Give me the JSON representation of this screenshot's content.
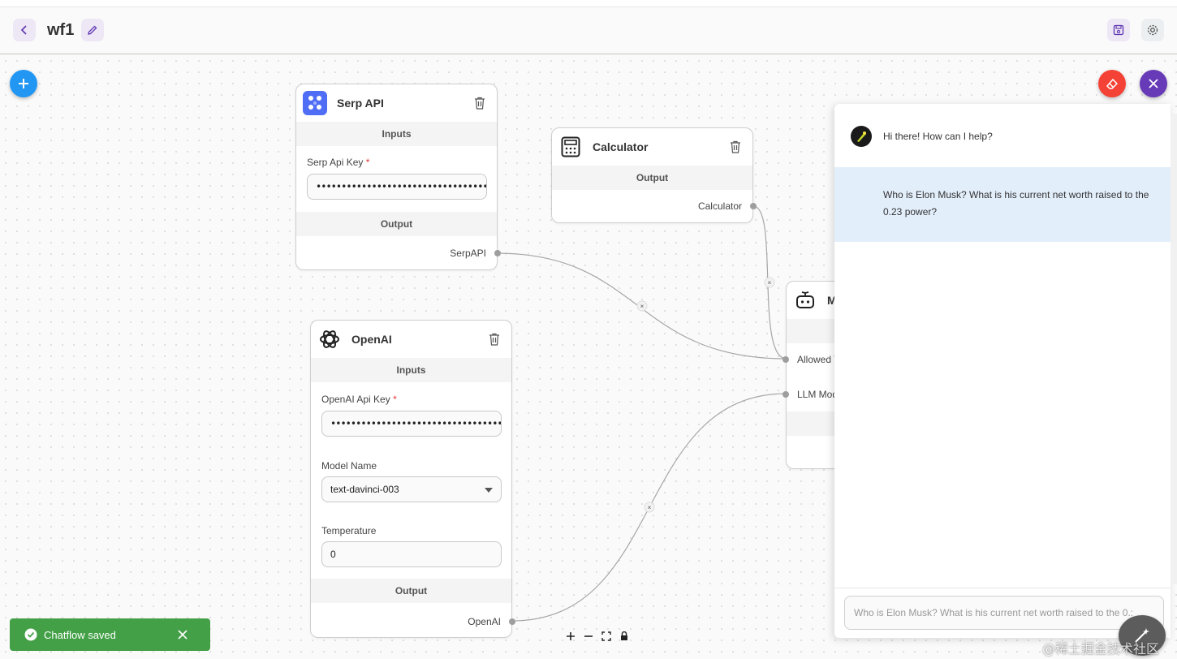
{
  "header": {
    "title": "wf1"
  },
  "nodes": {
    "serp": {
      "title": "Serp API",
      "inputs_label": "Inputs",
      "key_label": "Serp Api Key",
      "key_value": "••••••••••••••••••••••••••••••••••••••••••••",
      "output_label": "Output",
      "output_name": "SerpAPI"
    },
    "calculator": {
      "title": "Calculator",
      "output_label": "Output",
      "output_name": "Calculator"
    },
    "openai": {
      "title": "OpenAI",
      "inputs_label": "Inputs",
      "key_label": "OpenAI Api Key",
      "key_value": "•••••••••••••••••••••••••••••••••••••••••••••••••",
      "model_label": "Model Name",
      "model_value": "text-davinci-003",
      "temp_label": "Temperature",
      "temp_value": "0",
      "output_label": "Output",
      "output_name": "OpenAI"
    },
    "agent": {
      "title_partial": "M",
      "allowed_partial": "Allowed T",
      "llm_partial": "LLM Mod"
    }
  },
  "required_marker": "*",
  "chat": {
    "bot_message": "Hi there! How can I help?",
    "user_message": "Who is Elon Musk? What is his current net worth raised to the 0.23 power?",
    "input_value": "Who is Elon Musk? What is his current net worth raised to the 0.:"
  },
  "toast": {
    "message": "Chatflow saved"
  },
  "watermark": "@稀土掘金技术社区",
  "colors": {
    "add_fab": "#2196f3",
    "clear_fab": "#f44336",
    "close_fab": "#673ab7",
    "toast_bg": "#43a047",
    "user_msg_bg": "#e3eefb"
  },
  "icons": {
    "back": "chevron-left-icon",
    "edit": "pencil-icon",
    "save": "save-icon",
    "settings": "gear-icon",
    "add": "plus-icon",
    "clear": "eraser-icon",
    "close": "close-icon",
    "trash": "trash-icon",
    "magic": "magic-wand-icon"
  }
}
